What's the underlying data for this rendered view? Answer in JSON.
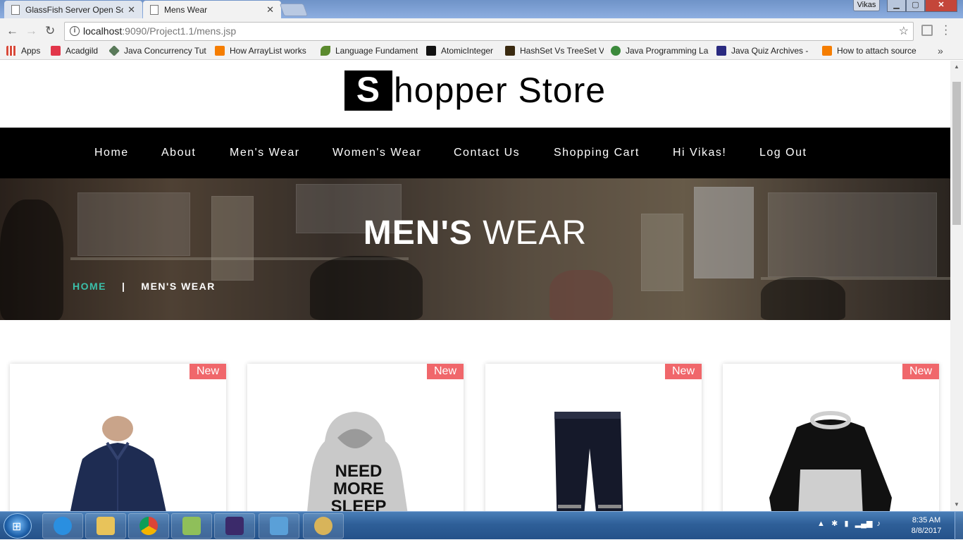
{
  "browser": {
    "tabs": [
      {
        "title": "GlassFish Server Open So",
        "active": false
      },
      {
        "title": "Mens Wear",
        "active": true
      }
    ],
    "window_user": "Vikas",
    "url_host": "localhost",
    "url_path": ":9090/Project1.1/mens.jsp",
    "bookmarks": [
      {
        "label": "Apps",
        "icon": "apps-grid-icon",
        "color": "#d84a3a"
      },
      {
        "label": "Acadgild",
        "icon": "acadgild-icon",
        "color": "#e2364a"
      },
      {
        "label": "Java Concurrency Tut",
        "icon": "diamond-icon",
        "color": "#5a7a5a"
      },
      {
        "label": "How ArrayList works",
        "icon": "blogger-icon",
        "color": "#f57d00"
      },
      {
        "label": "Language Fundament",
        "icon": "java-leaf-icon",
        "color": "#5b8a2e"
      },
      {
        "label": "AtomicInteger",
        "icon": "j-icon",
        "color": "#111111"
      },
      {
        "label": "HashSet Vs TreeSet V",
        "icon": "site-icon",
        "color": "#3a2a10"
      },
      {
        "label": "Java Programming La",
        "icon": "tree-icon",
        "color": "#3c8a3c"
      },
      {
        "label": "Java Quiz Archives - ",
        "icon": "quiz-icon",
        "color": "#2a2a80"
      },
      {
        "label": "How to attach source",
        "icon": "blogger-icon",
        "color": "#f57d00"
      }
    ]
  },
  "site": {
    "logo_letter": "S",
    "logo_rest": "hopper Store",
    "nav": [
      "Home",
      "About",
      "Men's Wear",
      "Women's Wear",
      "Contact Us",
      "Shopping Cart",
      "Hi Vikas!",
      "Log Out"
    ],
    "hero": {
      "title_bold": "MEN'S",
      "title_light": " WEAR",
      "breadcrumb_home": "HOME",
      "breadcrumb_sep": "|",
      "breadcrumb_current": "MEN'S WEAR"
    },
    "products": [
      {
        "badge": "New",
        "item": "shirt",
        "color": "#1e2c52"
      },
      {
        "badge": "New",
        "item": "hoodie",
        "color": "#c9c9c9",
        "print_text": "NEED MORE SLEEP"
      },
      {
        "badge": "New",
        "item": "track pants",
        "color": "#15192a"
      },
      {
        "badge": "New",
        "item": "raglan tee",
        "color": "#111111"
      }
    ],
    "accent": "#3bbfa9",
    "badge_color": "#f0676b"
  },
  "taskbar": {
    "apps": [
      {
        "name": "internet-explorer-icon",
        "color": "#2a8fe0"
      },
      {
        "name": "file-explorer-icon",
        "color": "#e8c35a"
      },
      {
        "name": "chrome-icon",
        "color": "#db4437"
      },
      {
        "name": "notepad-icon",
        "color": "#8fbf5a"
      },
      {
        "name": "eclipse-ide-icon",
        "color": "#3b2a6a"
      },
      {
        "name": "media-player-icon",
        "color": "#5aa0d8"
      },
      {
        "name": "paint-icon",
        "color": "#d8b45a"
      }
    ],
    "time": "8:35 AM",
    "date": "8/8/2017"
  }
}
